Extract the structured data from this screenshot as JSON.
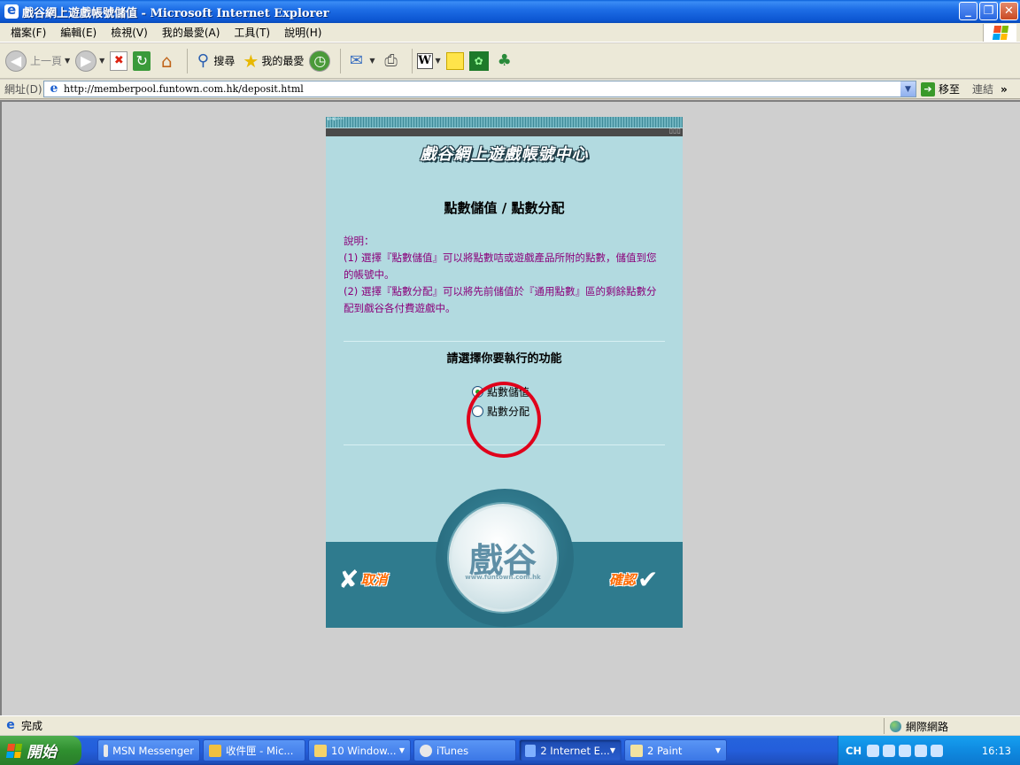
{
  "window": {
    "title": "戲谷網上遊戲帳號儲值 - Microsoft Internet Explorer",
    "controls": [
      "_",
      "❐",
      "✕"
    ]
  },
  "menu": [
    "檔案(F)",
    "編輯(E)",
    "檢視(V)",
    "我的最愛(A)",
    "工具(T)",
    "說明(H)"
  ],
  "toolbar": {
    "back_label": "上一頁",
    "search_label": "搜尋",
    "favorites_label": "我的最愛"
  },
  "address": {
    "label": "網址(D)",
    "url": "http://memberpool.funtown.com.hk/deposit.html",
    "go_label": "移至",
    "links_label": "連結"
  },
  "page": {
    "header": "戲谷網上遊戲帳號中心",
    "title": "點數儲值 / 點數分配",
    "desc_heading": "說明：",
    "desc_line1": "(1) 選擇『點數儲值』可以將點數咭或遊戲產品所附的點數，儲值到您的帳號中。",
    "desc_line2": "(2) 選擇『點數分配』可以將先前儲值於『通用點數』區的剩餘點數分配到戲谷各付費遊戲中。",
    "choose_label": "請選擇你要執行的功能",
    "options": [
      {
        "label": "點數儲值",
        "checked": true
      },
      {
        "label": "點數分配",
        "checked": false
      }
    ],
    "cancel_label": "取消",
    "confirm_label": "確認",
    "logo_text": "戲谷",
    "logo_url": "www.funtown.com.hk"
  },
  "status": {
    "text": "完成",
    "zone": "網際網路"
  },
  "taskbar": {
    "start_label": "開始",
    "items": [
      {
        "label": "MSN Messenger",
        "active": false
      },
      {
        "label": "收件匣 - Mic...",
        "active": false
      },
      {
        "label": "10 Window...",
        "active": false
      },
      {
        "label": "iTunes",
        "active": false
      },
      {
        "label": "2 Internet E...",
        "active": true
      },
      {
        "label": "2 Paint",
        "active": false
      }
    ],
    "lang": "CH",
    "clock": "16:13"
  },
  "colors": {
    "panel_bg": "#b2dae0",
    "desc_text": "#8a007a",
    "highlight_circle": "#e0001b",
    "button_text": "#ff6a00"
  }
}
